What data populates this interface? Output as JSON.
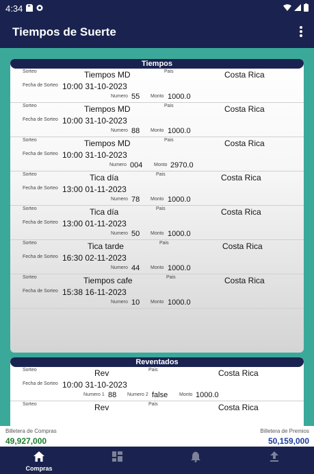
{
  "status_bar": {
    "time": "4:34"
  },
  "app_bar": {
    "title": "Tiempos de Suerte"
  },
  "tiempos": {
    "header": "Tiempos",
    "labels": {
      "sorteo": "Sorteo",
      "pais": "Pais",
      "fecha": "Fecha de Sorteo",
      "numero": "Numero",
      "monto": "Monto"
    },
    "items": [
      {
        "sorteo": "Tiempos MD",
        "pais": "Costa Rica",
        "fecha": "10:00 31-10-2023",
        "numero": "55",
        "monto": "1000.0"
      },
      {
        "sorteo": "Tiempos MD",
        "pais": "Costa Rica",
        "fecha": "10:00 31-10-2023",
        "numero": "88",
        "monto": "1000.0"
      },
      {
        "sorteo": "Tiempos MD",
        "pais": "Costa Rica",
        "fecha": "10:00 31-10-2023",
        "numero": "004",
        "monto": "2970.0"
      },
      {
        "sorteo": "Tica día",
        "pais": "Costa Rica",
        "fecha": "13:00 01-11-2023",
        "numero": "78",
        "monto": "1000.0"
      },
      {
        "sorteo": "Tica día",
        "pais": "Costa Rica",
        "fecha": "13:00 01-11-2023",
        "numero": "50",
        "monto": "1000.0"
      },
      {
        "sorteo": "Tica tarde",
        "pais": "Costa Rica",
        "fecha": "16:30 02-11-2023",
        "numero": "44",
        "monto": "1000.0"
      },
      {
        "sorteo": "Tiempos cafe",
        "pais": "Costa Rica",
        "fecha": "15:38 16-11-2023",
        "numero": "10",
        "monto": "1000.0"
      }
    ]
  },
  "reventados": {
    "header": "Reventados",
    "labels": {
      "sorteo": "Sorteo",
      "pais": "Pais",
      "fecha": "Fecha de Sorteo",
      "numero1": "Numero 1",
      "numero2": "Numero 2",
      "monto": "Monto"
    },
    "items": [
      {
        "sorteo": "Rev",
        "pais": "Costa Rica",
        "fecha": "10:00 31-10-2023",
        "numero1": "88",
        "numero2": "false",
        "monto": "1000.0"
      },
      {
        "sorteo": "Rev",
        "pais": "Costa Rica"
      }
    ]
  },
  "wallets": {
    "compras_label": "Billetera de Compras",
    "compras_value": "49,927,000",
    "premios_label": "Billetera de Premios",
    "premios_value": "50,159,000",
    "compras_color": "#1c7a2c",
    "premios_color": "#1a3a9a"
  },
  "bottom_nav": {
    "items": [
      {
        "label": "Compras",
        "icon": "home-icon",
        "active": true
      },
      {
        "label": "",
        "icon": "dashboard-icon",
        "active": false
      },
      {
        "label": "",
        "icon": "bell-icon",
        "active": false
      },
      {
        "label": "",
        "icon": "upload-icon",
        "active": false
      }
    ]
  },
  "colors": {
    "primary": "#1a2350",
    "background": "#3aa99a"
  }
}
